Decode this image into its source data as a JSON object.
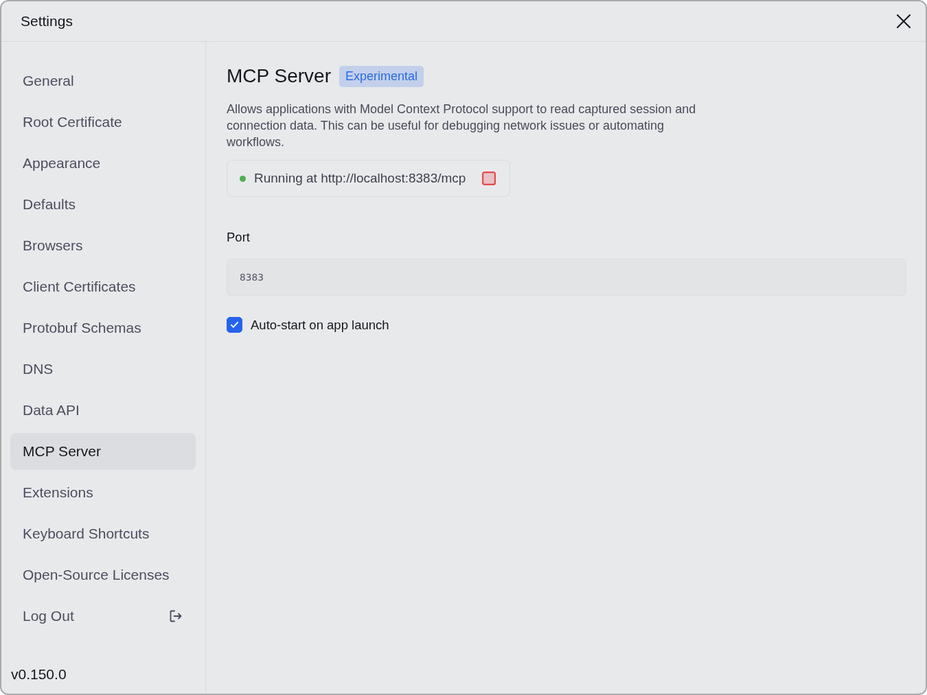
{
  "window": {
    "title": "Settings"
  },
  "sidebar": {
    "items": [
      {
        "label": "General",
        "selected": false,
        "kind": "page"
      },
      {
        "label": "Root Certificate",
        "selected": false,
        "kind": "page"
      },
      {
        "label": "Appearance",
        "selected": false,
        "kind": "page"
      },
      {
        "label": "Defaults",
        "selected": false,
        "kind": "page"
      },
      {
        "label": "Browsers",
        "selected": false,
        "kind": "page"
      },
      {
        "label": "Client Certificates",
        "selected": false,
        "kind": "page"
      },
      {
        "label": "Protobuf Schemas",
        "selected": false,
        "kind": "page"
      },
      {
        "label": "DNS",
        "selected": false,
        "kind": "page"
      },
      {
        "label": "Data API",
        "selected": false,
        "kind": "page"
      },
      {
        "label": "MCP Server",
        "selected": true,
        "kind": "page"
      },
      {
        "label": "Extensions",
        "selected": false,
        "kind": "page"
      },
      {
        "label": "Keyboard Shortcuts",
        "selected": false,
        "kind": "page"
      },
      {
        "label": "Open-Source Licenses",
        "selected": false,
        "kind": "page"
      },
      {
        "label": "Log Out",
        "selected": false,
        "kind": "action"
      }
    ],
    "version": "v0.150.0"
  },
  "content": {
    "title": "MCP Server",
    "badge": "Experimental",
    "description": "Allows applications with Model Context Protocol support to read captured session and connection data. This can be useful for debugging network issues or automating workflows.",
    "status": {
      "running": true,
      "text": "Running at http://localhost:8383/mcp"
    },
    "port": {
      "label": "Port",
      "value": "8383"
    },
    "auto_start": {
      "label": "Auto-start on app launch",
      "checked": true
    }
  }
}
